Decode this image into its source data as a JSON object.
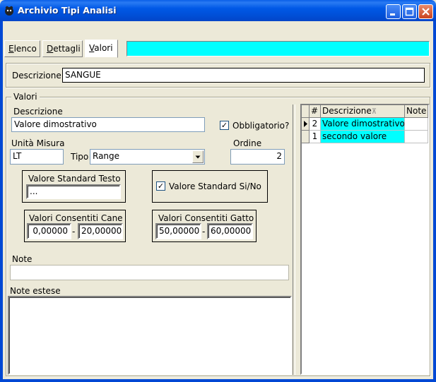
{
  "window": {
    "title": "Archivio Tipi Analisi"
  },
  "tabs": [
    {
      "label": "Elenco",
      "active": false
    },
    {
      "label": "Dettagli",
      "active": false
    },
    {
      "label": "Valori",
      "active": true
    }
  ],
  "descrizione": {
    "label": "Descrizione",
    "value": "SANGUE"
  },
  "valori_group": {
    "title": "Valori",
    "descrizione_label": "Descrizione",
    "descrizione_value": "Valore dimostrativo",
    "obbligatorio_label": "Obbligatorio?",
    "obbligatorio_checked": true,
    "unita_label": "Unità Misura",
    "unita_value": "LT",
    "tipo_label": "Tipo",
    "tipo_value": "Range",
    "ordine_label": "Ordine",
    "ordine_value": "2",
    "std_testo_title": "Valore Standard Testo",
    "std_testo_value": "...",
    "std_sino_label": "Valore Standard Si/No",
    "std_sino_checked": true,
    "cane_title": "Valori Consentiti Cane",
    "cane_min": "0,00000",
    "cane_max": "20,00000",
    "gatto_title": "Valori Consentiti Gatto",
    "gatto_min": "50,00000",
    "gatto_max": "60,00000",
    "range_sep": "-",
    "note_label": "Note",
    "note_value": "",
    "note_estese_label": "Note estese",
    "note_estese_value": ""
  },
  "grid": {
    "columns": [
      "#",
      "Descrizione",
      "Note"
    ],
    "rows": [
      {
        "num": "2",
        "descrizione": "Valore dimostrativo",
        "note": "",
        "current": true
      },
      {
        "num": "1",
        "descrizione": "secondo valore",
        "note": "",
        "current": false
      }
    ]
  },
  "colors": {
    "highlight": "#00FFFF",
    "titlebar": "#0058E6"
  }
}
